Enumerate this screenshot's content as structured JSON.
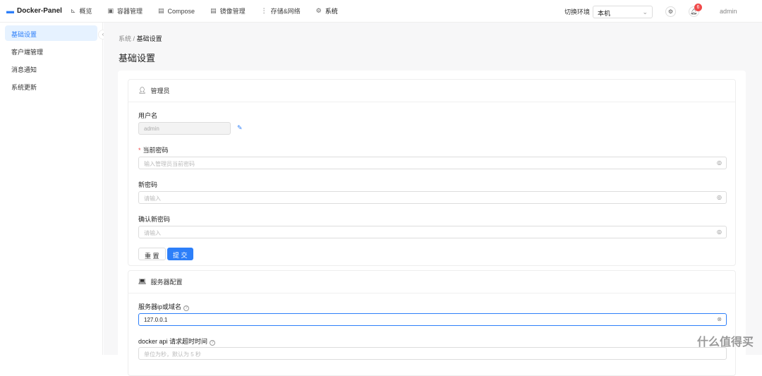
{
  "header": {
    "app_name": "Docker-Panel",
    "nav": [
      {
        "label": "概览",
        "icon": "chart-icon"
      },
      {
        "label": "容器管理",
        "icon": "image-icon"
      },
      {
        "label": "Compose",
        "icon": "compose-icon"
      },
      {
        "label": "镜像管理",
        "icon": "image-box-icon"
      },
      {
        "label": "存储&网络",
        "icon": "dots-icon"
      },
      {
        "label": "系统",
        "icon": "gear-icon"
      }
    ],
    "env_label": "切换环境",
    "env_value": "本机",
    "notification_count": "6",
    "user": "admin"
  },
  "sidebar": {
    "items": [
      {
        "label": "基础设置"
      },
      {
        "label": "客户端管理"
      },
      {
        "label": "消息通知"
      },
      {
        "label": "系统更新"
      }
    ]
  },
  "breadcrumb": {
    "parent": "系统",
    "sep": "/",
    "current": "基础设置"
  },
  "page_title": "基础设置",
  "admin_card": {
    "title": "管理员",
    "username_label": "用户名",
    "username_value": "admin",
    "current_pw_label": "当前密码",
    "current_pw_placeholder": "输入管理员当前密码",
    "new_pw_label": "新密码",
    "new_pw_placeholder": "请输入",
    "confirm_pw_label": "确认新密码",
    "confirm_pw_placeholder": "请输入",
    "reset": "重 置",
    "submit": "提 交"
  },
  "server_card": {
    "title": "服务器配置",
    "host_label": "服务器ip或域名",
    "host_value": "127.0.0.1",
    "timeout_label": "docker api 请求超时时间",
    "timeout_placeholder": "单位为秒，默认为 5 秒"
  },
  "watermark": "什么值得买"
}
